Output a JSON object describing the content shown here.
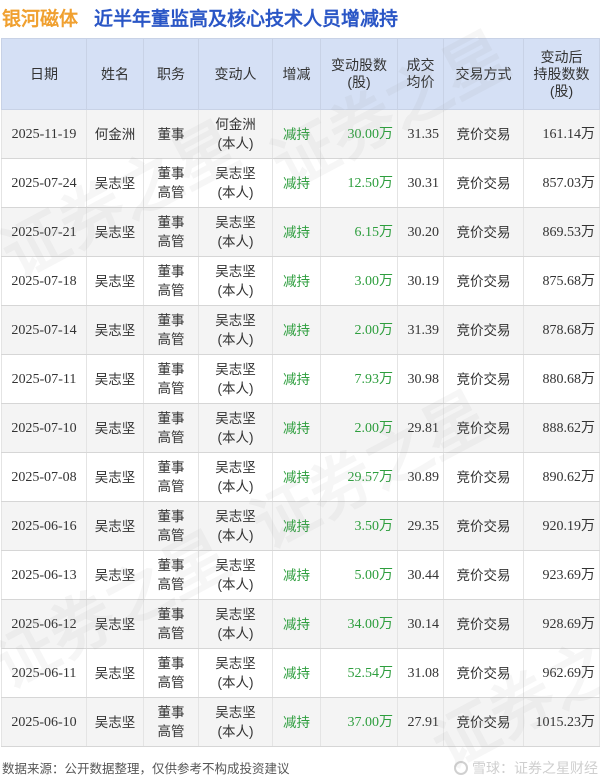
{
  "title": {
    "company": "银河磁体",
    "main": "近半年董监高及核心技术人员增减持"
  },
  "table": {
    "headers": {
      "date": "日期",
      "name": "姓名",
      "position": "职务",
      "changer": "变动人",
      "direction": "增减",
      "shares_line1": "变动股数",
      "shares_line2": "(股)",
      "price_line1": "成交",
      "price_line2": "均价",
      "method": "交易方式",
      "holding_line1": "变动后",
      "holding_line2": "持股数数",
      "holding_line3": "(股)"
    },
    "rows": [
      {
        "date": "2025-11-19",
        "name": "何金洲",
        "position_line1": "董事",
        "position_line2": "",
        "changer_line1": "何金洲",
        "changer_line2": "(本人)",
        "direction": "减持",
        "shares": "30.00万",
        "price": "31.35",
        "method": "竞价交易",
        "holding": "161.14万"
      },
      {
        "date": "2025-07-24",
        "name": "吴志坚",
        "position_line1": "董事",
        "position_line2": "高管",
        "changer_line1": "吴志坚",
        "changer_line2": "(本人)",
        "direction": "减持",
        "shares": "12.50万",
        "price": "30.31",
        "method": "竞价交易",
        "holding": "857.03万"
      },
      {
        "date": "2025-07-21",
        "name": "吴志坚",
        "position_line1": "董事",
        "position_line2": "高管",
        "changer_line1": "吴志坚",
        "changer_line2": "(本人)",
        "direction": "减持",
        "shares": "6.15万",
        "price": "30.20",
        "method": "竞价交易",
        "holding": "869.53万"
      },
      {
        "date": "2025-07-18",
        "name": "吴志坚",
        "position_line1": "董事",
        "position_line2": "高管",
        "changer_line1": "吴志坚",
        "changer_line2": "(本人)",
        "direction": "减持",
        "shares": "3.00万",
        "price": "30.19",
        "method": "竞价交易",
        "holding": "875.68万"
      },
      {
        "date": "2025-07-14",
        "name": "吴志坚",
        "position_line1": "董事",
        "position_line2": "高管",
        "changer_line1": "吴志坚",
        "changer_line2": "(本人)",
        "direction": "减持",
        "shares": "2.00万",
        "price": "31.39",
        "method": "竞价交易",
        "holding": "878.68万"
      },
      {
        "date": "2025-07-11",
        "name": "吴志坚",
        "position_line1": "董事",
        "position_line2": "高管",
        "changer_line1": "吴志坚",
        "changer_line2": "(本人)",
        "direction": "减持",
        "shares": "7.93万",
        "price": "30.98",
        "method": "竞价交易",
        "holding": "880.68万"
      },
      {
        "date": "2025-07-10",
        "name": "吴志坚",
        "position_line1": "董事",
        "position_line2": "高管",
        "changer_line1": "吴志坚",
        "changer_line2": "(本人)",
        "direction": "减持",
        "shares": "2.00万",
        "price": "29.81",
        "method": "竞价交易",
        "holding": "888.62万"
      },
      {
        "date": "2025-07-08",
        "name": "吴志坚",
        "position_line1": "董事",
        "position_line2": "高管",
        "changer_line1": "吴志坚",
        "changer_line2": "(本人)",
        "direction": "减持",
        "shares": "29.57万",
        "price": "30.89",
        "method": "竞价交易",
        "holding": "890.62万"
      },
      {
        "date": "2025-06-16",
        "name": "吴志坚",
        "position_line1": "董事",
        "position_line2": "高管",
        "changer_line1": "吴志坚",
        "changer_line2": "(本人)",
        "direction": "减持",
        "shares": "3.50万",
        "price": "29.35",
        "method": "竞价交易",
        "holding": "920.19万"
      },
      {
        "date": "2025-06-13",
        "name": "吴志坚",
        "position_line1": "董事",
        "position_line2": "高管",
        "changer_line1": "吴志坚",
        "changer_line2": "(本人)",
        "direction": "减持",
        "shares": "5.00万",
        "price": "30.44",
        "method": "竞价交易",
        "holding": "923.69万"
      },
      {
        "date": "2025-06-12",
        "name": "吴志坚",
        "position_line1": "董事",
        "position_line2": "高管",
        "changer_line1": "吴志坚",
        "changer_line2": "(本人)",
        "direction": "减持",
        "shares": "34.00万",
        "price": "30.14",
        "method": "竞价交易",
        "holding": "928.69万"
      },
      {
        "date": "2025-06-11",
        "name": "吴志坚",
        "position_line1": "董事",
        "position_line2": "高管",
        "changer_line1": "吴志坚",
        "changer_line2": "(本人)",
        "direction": "减持",
        "shares": "52.54万",
        "price": "31.08",
        "method": "竞价交易",
        "holding": "962.69万"
      },
      {
        "date": "2025-06-10",
        "name": "吴志坚",
        "position_line1": "董事",
        "position_line2": "高管",
        "changer_line1": "吴志坚",
        "changer_line2": "(本人)",
        "direction": "减持",
        "shares": "37.00万",
        "price": "27.91",
        "method": "竞价交易",
        "holding": "1015.23万"
      }
    ]
  },
  "footer": {
    "source": "数据来源：公开数据整理，仅供参考不构成投资建议",
    "brand": "雪球：证券之星财经"
  },
  "watermark_text": "证券之星",
  "colors": {
    "company": "#f0a030",
    "title": "#2a56c6",
    "header_bg": "#d5e0f5",
    "reduce_green": "#2e9e3e"
  },
  "icons": {
    "brand": "snowball-logo-icon"
  }
}
